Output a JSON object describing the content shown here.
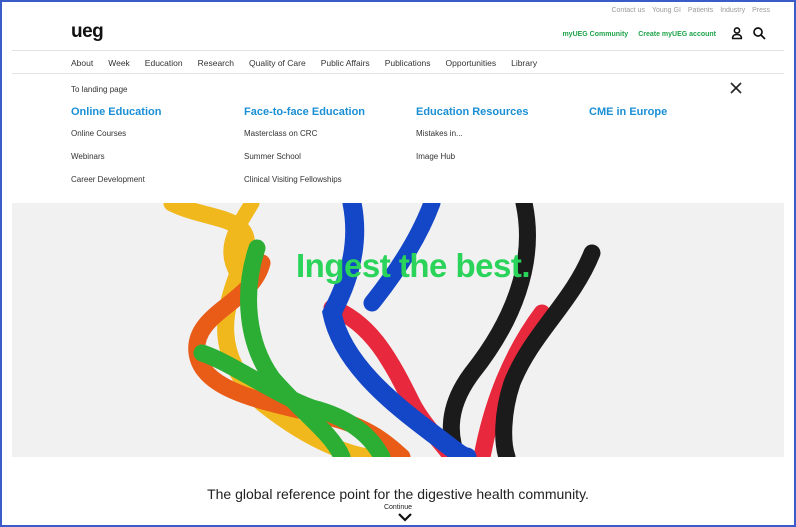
{
  "header": {
    "logo": "ueg",
    "utility_links": [
      "Contact us",
      "Young GI",
      "Patients",
      "Industry",
      "Press"
    ],
    "community_link": "myUEG Community",
    "create_account": "Create myUEG account"
  },
  "nav": {
    "items": [
      "About",
      "Week",
      "Education",
      "Research",
      "Quality of Care",
      "Public Affairs",
      "Publications",
      "Opportunities",
      "Library"
    ]
  },
  "menu": {
    "landing": "To landing page",
    "columns": [
      {
        "title": "Online Education",
        "links": [
          "Online Courses",
          "Webinars",
          "Career Development"
        ]
      },
      {
        "title": "Face-to-face Education",
        "links": [
          "Masterclass on CRC",
          "Summer School",
          "Clinical Visiting Fellowships"
        ]
      },
      {
        "title": "Education Resources",
        "links": [
          "Mistakes in...",
          "Image Hub"
        ]
      },
      {
        "title": "CME in Europe",
        "links": []
      }
    ]
  },
  "hero": {
    "tagline": "Ingest the best."
  },
  "mission": {
    "text": "The global reference point for the digestive health community.",
    "continue": "Continue"
  },
  "colors": {
    "accent_green": "#2ad35a",
    "link_green": "#1ea34a",
    "heading_blue": "#1a8fd6"
  }
}
